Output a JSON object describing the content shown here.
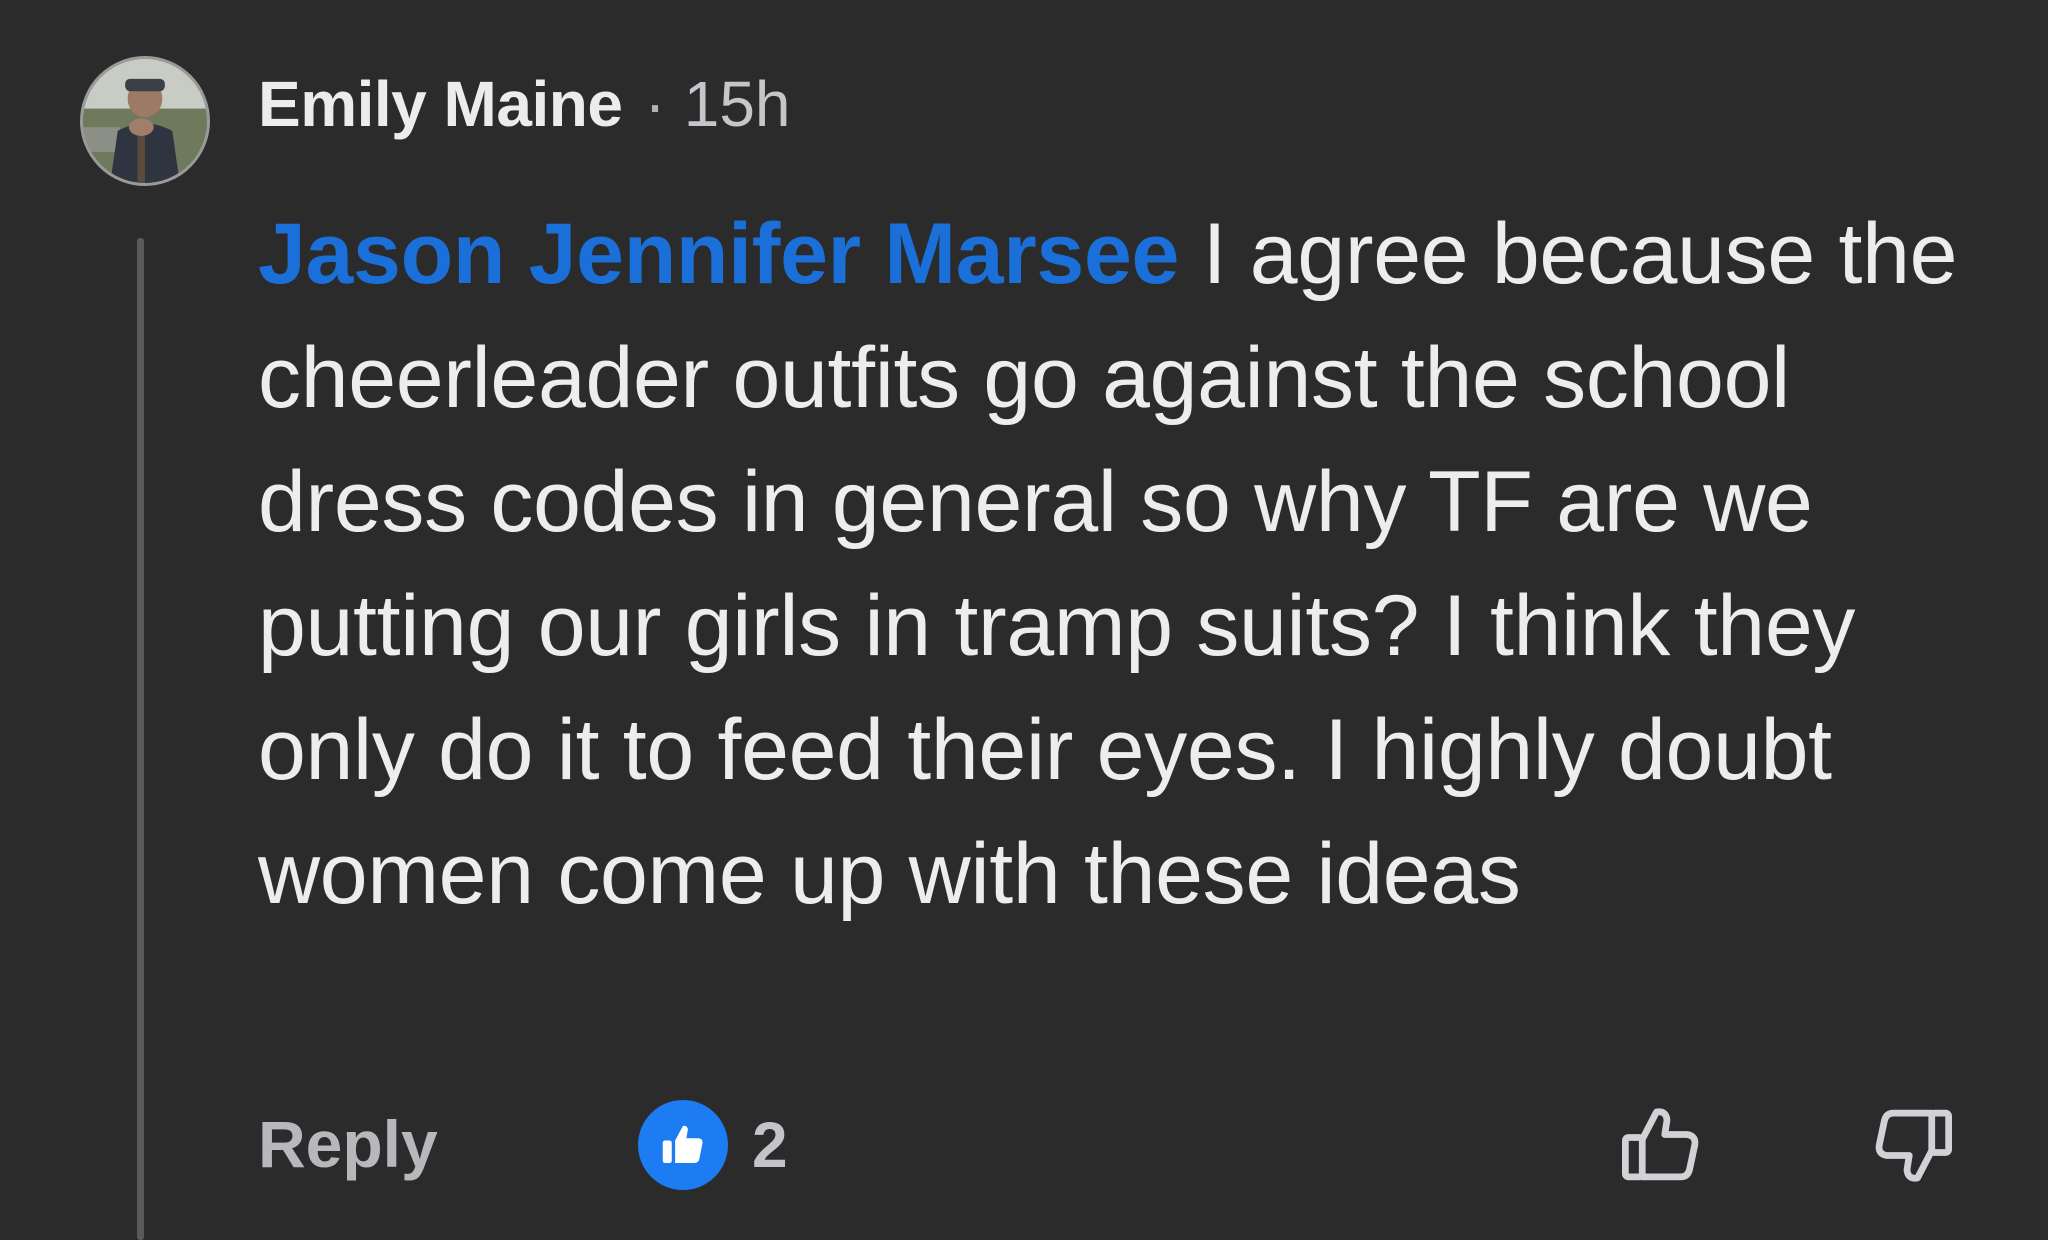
{
  "comment": {
    "author": "Emily Maine",
    "separator": "·",
    "time": "15h",
    "mention": "Jason Jennifer Marsee",
    "text": "I agree because the cheerleader outfits go against the school dress codes in general so why TF are we putting our girls in tramp suits? I think they only do it to feed their eyes. I highly doubt women come up with these ideas",
    "reply_label": "Reply",
    "reaction_count": "2",
    "reaction_icon": "like-icon"
  },
  "colors": {
    "background": "#2b2b2c",
    "mention": "#1b6fd8",
    "like_badge": "#1d7cf2"
  }
}
